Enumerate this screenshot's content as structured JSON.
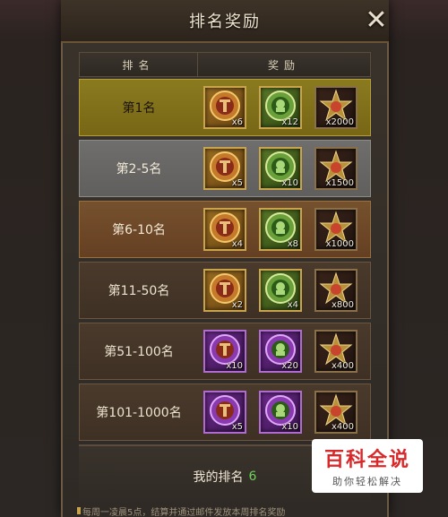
{
  "window": {
    "title": "排名奖励",
    "close_glyph": "✕"
  },
  "table": {
    "headers": {
      "rank": "排名",
      "reward": "奖励"
    },
    "rows": [
      {
        "rank": "第1名",
        "tier": "r1",
        "rewards": [
          {
            "icon": "bronze-medallion-icon",
            "frame": "gold-frame",
            "qty": "x6"
          },
          {
            "icon": "green-medallion-icon",
            "frame": "green-frame",
            "qty": "x12"
          },
          {
            "icon": "star-emblem-icon",
            "frame": "dark-frame",
            "qty": "x2000"
          }
        ]
      },
      {
        "rank": "第2-5名",
        "tier": "r2",
        "rewards": [
          {
            "icon": "bronze-medallion-icon",
            "frame": "gold-frame",
            "qty": "x5"
          },
          {
            "icon": "green-medallion-icon",
            "frame": "green-frame",
            "qty": "x10"
          },
          {
            "icon": "star-emblem-icon",
            "frame": "dark-frame",
            "qty": "x1500"
          }
        ]
      },
      {
        "rank": "第6-10名",
        "tier": "r3",
        "rewards": [
          {
            "icon": "bronze-medallion-icon",
            "frame": "gold-frame",
            "qty": "x4"
          },
          {
            "icon": "green-medallion-icon",
            "frame": "green-frame",
            "qty": "x8"
          },
          {
            "icon": "star-emblem-icon",
            "frame": "dark-frame",
            "qty": "x1000"
          }
        ]
      },
      {
        "rank": "第11-50名",
        "tier": "r4",
        "rewards": [
          {
            "icon": "bronze-medallion-icon",
            "frame": "gold-frame",
            "qty": "x2"
          },
          {
            "icon": "green-medallion-icon",
            "frame": "green-frame",
            "qty": "x4"
          },
          {
            "icon": "star-emblem-icon",
            "frame": "dark-frame",
            "qty": "x800"
          }
        ]
      },
      {
        "rank": "第51-100名",
        "tier": "r5",
        "rewards": [
          {
            "icon": "purple-medallion-icon",
            "frame": "purple-frame",
            "qty": "x10"
          },
          {
            "icon": "purple-green-medallion-icon",
            "frame": "purple-frame",
            "qty": "x20"
          },
          {
            "icon": "star-emblem-icon",
            "frame": "dark-frame",
            "qty": "x400"
          }
        ]
      },
      {
        "rank": "第101-1000名",
        "tier": "r6",
        "rewards": [
          {
            "icon": "purple-medallion-icon",
            "frame": "purple-frame",
            "qty": "x5"
          },
          {
            "icon": "purple-green-medallion-icon",
            "frame": "purple-frame",
            "qty": "x10"
          },
          {
            "icon": "star-emblem-icon",
            "frame": "dark-frame",
            "qty": "x400"
          }
        ]
      }
    ]
  },
  "footer": {
    "my_rank_label": "我的排名",
    "my_rank_value": "6"
  },
  "note": "每周一凌晨5点，结算并通过邮件发放本周排名奖励",
  "watermark": {
    "main": "百科全说",
    "sub": "助你轻松解决"
  },
  "colors": {
    "accent_gold": "#c9a44c",
    "my_rank_green": "#6fd35a",
    "watermark_red": "#d9282a"
  }
}
